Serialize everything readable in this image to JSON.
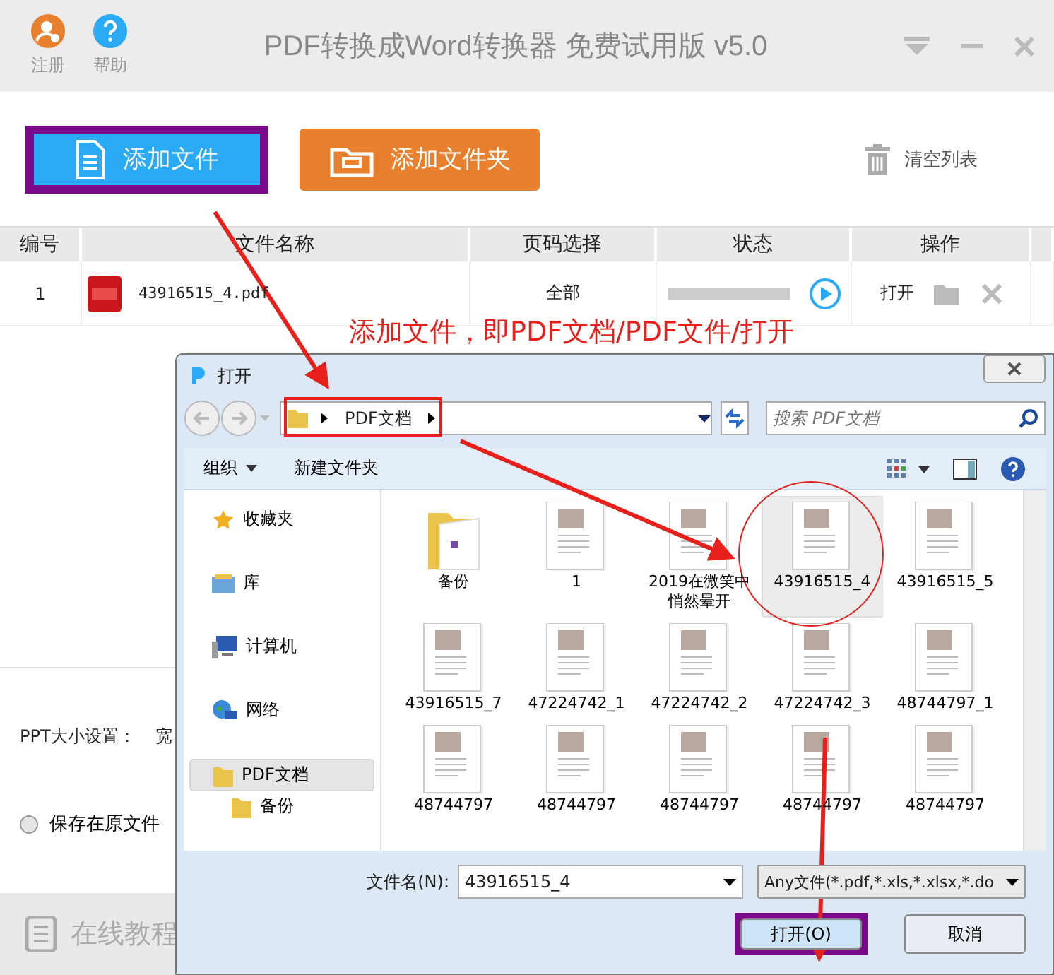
{
  "app": {
    "title": "PDF转换成Word转换器 免费试用版 v5.0",
    "top_buttons": [
      {
        "label": "注册",
        "kind": "register"
      },
      {
        "label": "帮助",
        "kind": "help"
      }
    ],
    "toolbar": {
      "add_file": "添加文件",
      "add_folder": "添加文件夹",
      "clear": "清空列表"
    },
    "table": {
      "columns": [
        "编号",
        "文件名称",
        "页码选择",
        "状态",
        "操作"
      ],
      "rows": [
        {
          "index": "1",
          "name": "43916515_4.pdf",
          "pages": "全部",
          "level": 0,
          "action": "打开"
        }
      ]
    },
    "ppt_size_label": "PPT大小设置：",
    "ppt_width_label": "宽",
    "save_option": {
      "label": "保存在原文件",
      "selected": false
    },
    "tutorial": "在线教程"
  },
  "dialog": {
    "title": "打开",
    "path": [
      "PDF文档"
    ],
    "search_placeholder": "搜索 PDF文档",
    "commands": [
      "组织",
      "新建文件夹"
    ],
    "nav": [
      {
        "label": "收藏夹",
        "kind": "favorites",
        "selected": false
      },
      {
        "label": "库",
        "kind": "library",
        "selected": false
      },
      {
        "label": "计算机",
        "kind": "computer",
        "selected": false
      },
      {
        "label": "网络",
        "kind": "network",
        "selected": false
      },
      {
        "label": "PDF文档",
        "kind": "folder",
        "selected": true,
        "children": [
          {
            "label": "备份",
            "kind": "folder",
            "selected": false
          }
        ]
      }
    ],
    "files": [
      {
        "name": "备份",
        "kind": "folder",
        "selected": false
      },
      {
        "name": "1",
        "kind": "document",
        "selected": false
      },
      {
        "name": "2019在微笑中悄然晕开",
        "kind": "document",
        "selected": false
      },
      {
        "name": "43916515_4",
        "kind": "document",
        "selected": true
      },
      {
        "name": "43916515_5",
        "kind": "document",
        "selected": false
      },
      {
        "name": "43916515_7",
        "kind": "document",
        "selected": false
      },
      {
        "name": "47224742_1",
        "kind": "document",
        "selected": false
      },
      {
        "name": "47224742_2",
        "kind": "document",
        "selected": false
      },
      {
        "name": "47224742_3",
        "kind": "document",
        "selected": false
      },
      {
        "name": "48744797_1",
        "kind": "document",
        "selected": false
      },
      {
        "name": "48744797",
        "kind": "document",
        "selected": false
      },
      {
        "name": "48744797",
        "kind": "document",
        "selected": false
      },
      {
        "name": "48744797",
        "kind": "document",
        "selected": false
      },
      {
        "name": "48744797",
        "kind": "document",
        "selected": false
      },
      {
        "name": "48744797",
        "kind": "document",
        "selected": false
      }
    ],
    "filename_label": "文件名(N):",
    "filename": "43916515_4",
    "filetype": "Any文件(*.pdf,*.xls,*.xlsx,*.do",
    "buttons": [
      "打开(O)",
      "取消"
    ]
  },
  "annotation": {
    "caption": "添加文件，即PDF文档/PDF文件/打开"
  }
}
